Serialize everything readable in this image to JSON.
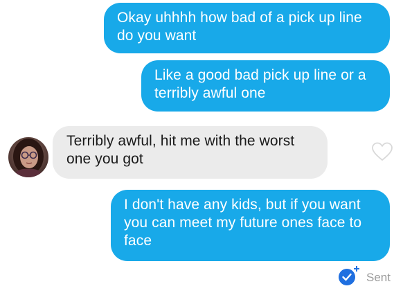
{
  "conversation": {
    "messages": [
      {
        "direction": "sent",
        "text": "Okay uhhhh how bad of a pick up line\ndo you want"
      },
      {
        "direction": "sent",
        "text": "Like a good bad pick up line or a\nterribly awful one"
      },
      {
        "direction": "received",
        "text": "Terribly awful, hit me with the worst\none you got"
      },
      {
        "direction": "sent",
        "text": "I don't have any kids, but if you want\nyou can meet my future ones face to\nface"
      }
    ],
    "status": "Sent"
  },
  "icons": {
    "like": "heart-outline-icon",
    "read_receipt": "checkmark-plus-icon",
    "avatar": "contact-avatar"
  },
  "colors": {
    "sent_bubble": "#18a9e9",
    "received_bubble": "#ebebeb",
    "status_text": "#9b9b9b",
    "receipt_badge": "#1f6fe0"
  }
}
